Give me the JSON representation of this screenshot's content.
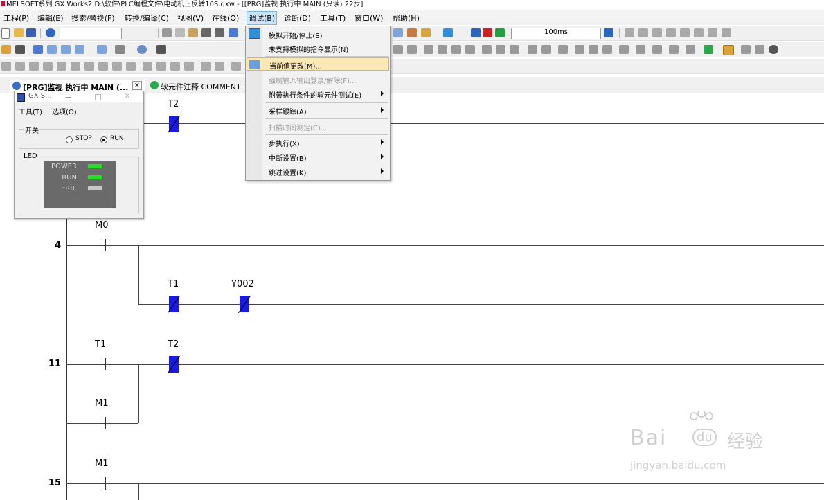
{
  "window": {
    "title": "MELSOFT系列 GX Works2 D:\\软件\\PLC编程文件\\电动机正反转10S.gxw - [[PRG]监视 执行中 MAIN (只读) 22步]"
  },
  "menubar": [
    "工程(P)",
    "编辑(E)",
    "搜索/替换(F)",
    "转换/编译(C)",
    "视图(V)",
    "在线(O)",
    "调试(B)",
    "诊断(D)",
    "工具(T)",
    "窗口(W)",
    "帮助(H)"
  ],
  "toolbar": {
    "interval": "100ms"
  },
  "tabs": [
    {
      "label": "[PRG]监视 执行中 MAIN (...",
      "close": "×"
    },
    {
      "label": "软元件注释 COMMENT"
    }
  ],
  "dropdown": {
    "items": [
      {
        "label": "模拟开始/停止(S)",
        "disabled": false,
        "submenu": false,
        "highlighted": false
      },
      {
        "label": "未支持模拟的指令显示(N)",
        "disabled": false,
        "submenu": false,
        "highlighted": false
      },
      {
        "label": "当前值更改(M)...",
        "disabled": false,
        "submenu": false,
        "highlighted": true
      },
      {
        "label": "强制输入输出登录/解除(F)...",
        "disabled": true,
        "submenu": false,
        "highlighted": false
      },
      {
        "label": "附带执行条件的软元件测试(E)",
        "disabled": false,
        "submenu": true,
        "highlighted": false
      },
      {
        "label": "采样跟踪(A)",
        "disabled": false,
        "submenu": true,
        "highlighted": false
      },
      {
        "label": "扫描时间测定(C)...",
        "disabled": true,
        "submenu": false,
        "highlighted": false
      },
      {
        "label": "步执行(X)",
        "disabled": false,
        "submenu": true,
        "highlighted": false
      },
      {
        "label": "中断设置(B)",
        "disabled": false,
        "submenu": true,
        "highlighted": false
      },
      {
        "label": "跳过设置(K)",
        "disabled": false,
        "submenu": true,
        "highlighted": false
      }
    ]
  },
  "simulator": {
    "title": "GX S...",
    "menu": [
      "工具(T)",
      "选项(O)"
    ],
    "switch_group": "开关",
    "stop_label": "STOP",
    "run_label": "RUN",
    "mode": "RUN",
    "led_group": "LED",
    "leds": [
      {
        "label": "POWER",
        "color": "#22e022"
      },
      {
        "label": "RUN",
        "color": "#22e022"
      },
      {
        "label": "ERR.",
        "color": "#c8c8c8"
      }
    ]
  },
  "ladder": {
    "rungs": [
      {
        "step": "4",
        "labels": {
          "contact1": "M0",
          "coil1": "T1",
          "coil2": "Y002"
        }
      },
      {
        "step": "11",
        "labels": {
          "contact1": "T1",
          "coil1": "T2",
          "parallel": "M1"
        }
      },
      {
        "step": "15",
        "labels": {
          "contact1": "M1"
        }
      }
    ],
    "top_coil": "T2"
  },
  "watermark": {
    "line1": "Bai",
    "line2": "经验",
    "url": "jingyan.baidu.com"
  }
}
